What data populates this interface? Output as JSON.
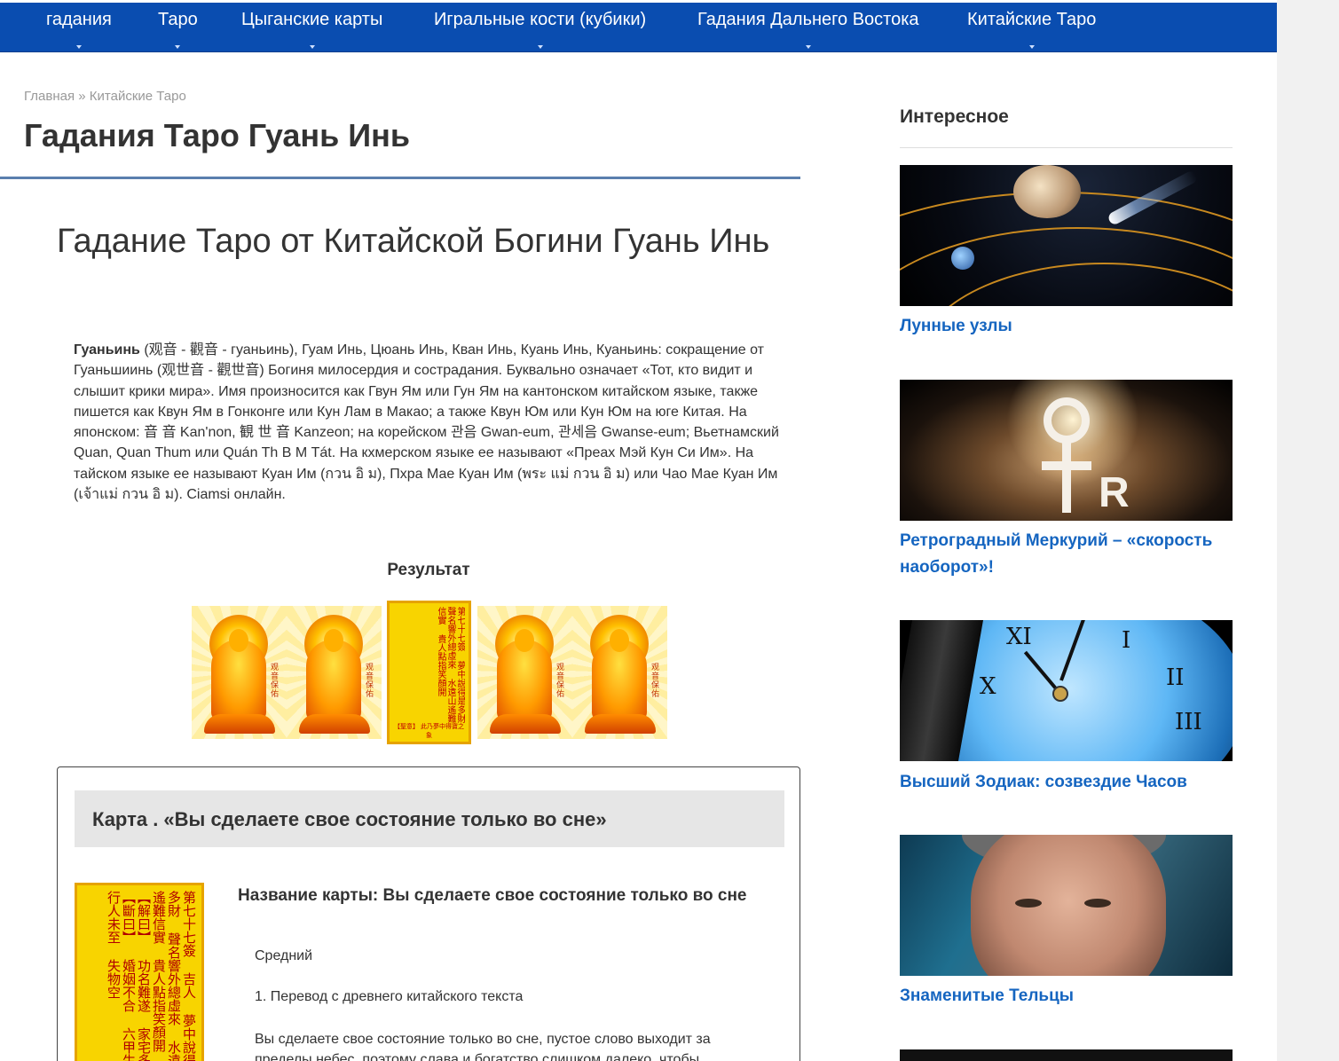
{
  "nav": {
    "items": [
      {
        "label": "гадания",
        "caret": true
      },
      {
        "label": "Таро",
        "caret": true
      },
      {
        "label": "Цыганские карты",
        "caret": true
      },
      {
        "label": "Игральные кости (кубики)",
        "caret": true
      },
      {
        "label": "Гадания Дальнего Востока",
        "caret": true
      },
      {
        "label": "Китайские Таро",
        "caret": true
      }
    ]
  },
  "breadcrumb": {
    "home": "Главная",
    "separator": " » ",
    "current": "Китайские Таро"
  },
  "page_title": "Гадания Таро Гуань Инь",
  "article": {
    "heading": "Гадание Таро от Китайской Богини Гуань Инь",
    "intro_bold": "Гуаньинь",
    "intro_text": " (观音 - 觀音 - гуаньинь), Гуам Инь, Цюань Инь, Кван Инь, Куань Инь, Куаньинь: сокращение от Гуаньшиинь (观世音 - 觀世音) Богиня милосердия и сострадания. Буквально означает «Тот, кто видит и слышит крики мира». Имя произносится как Гвун Ям или Гун Ям на кантонском китайском языке, также пишется как Квун Ям в Гонконге или Кун Лам в Макао; а также Квун Юм или Кун Юм на юге Китая. На японском: 音 音 Kan'non, 観 世 音 Kanzeon; на корейском 관음 Gwan-eum, 관세음 Gwanse-eum; Вьетнамский Quan, Quan Thum или Quán Th В М Tát. На кхмерском языке ее называют «Преах Мэй Кун Си Им». На тайском языке ее называют Куан Им (กวน อิ ม), Пхра Мае Куан Им (พระ แม่ กวน อิ ม) или Чао Мае Куан Им (เจ้าแม่ กวน อิ ม). Ciamsi онлайн.",
    "result_label": "Результат"
  },
  "cards": {
    "back_label": "观音保佑",
    "open_text": "第七十七簽 夢中說得是多財 聲名響外總虛來 水遠山遙難信實 貴人點指笑顏開",
    "open_foot": "【聖意】 此乃夢中得寶之象"
  },
  "result_box": {
    "header": "Карта . «Вы сделаете свое состояние только во сне»",
    "card_name": "Название карты: Вы сделаете свое состояние только во сне",
    "rank": "Средний",
    "section": "1. Перевод с древнего китайского текста",
    "text": "Вы сделаете свое состояние только во сне, пустое слово выходит за пределы небес, поэтому слава и богатство слишком далеко, чтобы",
    "big_card_text": "第七十七簽 吉人 夢中說得是多財 聲名響外總虛來 水遠山遙難信實 貴人點指笑顏開 【解曰】 功名難遂 家宅多驚 【斷曰】 婚姻不合 六甲生女 行人未至 失物空"
  },
  "sidebar": {
    "title": "Интересное",
    "posts": [
      {
        "title": "Лунные узлы"
      },
      {
        "title": "Ретроградный Меркурий – «скорость наоборот»!"
      },
      {
        "title": "Высший Зодиак: созвездие Часов"
      },
      {
        "title": "Знаменитые Тельцы"
      }
    ]
  },
  "colors": {
    "nav_bg": "#0a4db0",
    "link": "#1565c0",
    "title_rule": "#5a7fae",
    "box_header_bg": "#e6e6e6"
  }
}
